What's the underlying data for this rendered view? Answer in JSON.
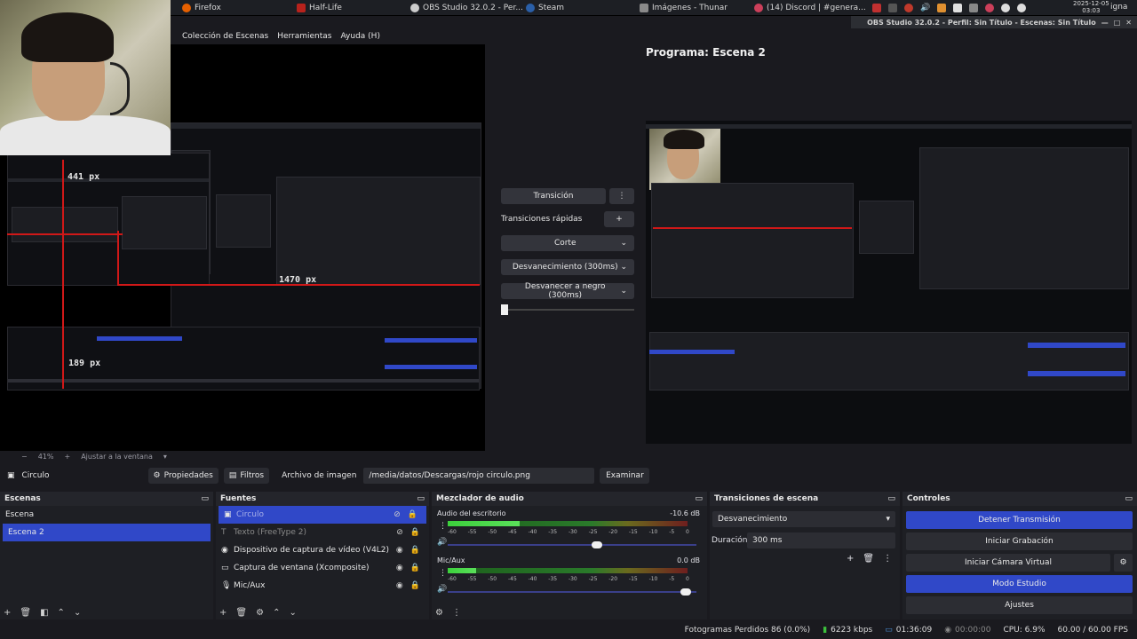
{
  "taskbar": {
    "items": [
      {
        "label": "Firefox",
        "color": "#e66000"
      },
      {
        "label": "Half-Life",
        "color": "#b8221c"
      },
      {
        "label": "OBS Studio 32.0.2 - Per...",
        "color": "#cccccc"
      },
      {
        "label": "Steam",
        "color": "#2a5fa8"
      },
      {
        "label": "Imágenes - Thunar",
        "color": "#8a8a8a"
      },
      {
        "label": "(14) Discord | #genera...",
        "color": "#cc3f5a"
      }
    ],
    "date": "2025-12-05",
    "time": "03:03",
    "user": "igna"
  },
  "window_title": "OBS Studio 32.0.2 - Perfil: Sin Título - Escenas: Sin Título",
  "menu": [
    "Colección de Escenas",
    "Herramientas",
    "Ayuda (H)"
  ],
  "preview": {
    "labels": [
      "441 px",
      "1470 px",
      "189 px"
    ],
    "zoom": "41%",
    "fit": "Ajustar a la ventana",
    "plus": "+",
    "minus": "−"
  },
  "transition_panel": {
    "transition_button": "Transición",
    "quick_label": "Transiciones rápidas",
    "items": [
      "Corte",
      "Desvanecimiento (300ms)",
      "Desvanecer a negro (300ms)"
    ]
  },
  "program": {
    "title": "Programa: Escena 2"
  },
  "source_toolbar": {
    "source": "Circulo",
    "properties": "Propiedades",
    "filters": "Filtros",
    "image_file_label": "Archivo de imagen",
    "image_path": "/media/datos/Descargas/rojo circulo.png",
    "browse": "Examinar"
  },
  "scenes": {
    "title": "Escenas",
    "items": [
      {
        "label": "Escena",
        "selected": false
      },
      {
        "label": "Escena 2",
        "selected": true
      }
    ]
  },
  "sources": {
    "title": "Fuentes",
    "items": [
      {
        "label": "Circulo",
        "icon": "image-icon",
        "visible": false,
        "selected": true
      },
      {
        "label": "Texto (FreeType 2)",
        "icon": "text-icon",
        "visible": false,
        "selected": false
      },
      {
        "label": "Dispositivo de captura de vídeo (V4L2)",
        "icon": "camera-icon",
        "visible": true,
        "selected": false
      },
      {
        "label": "Captura de ventana (Xcomposite)",
        "icon": "window-icon",
        "visible": true,
        "selected": false
      },
      {
        "label": "Mic/Aux",
        "icon": "mic-icon",
        "visible": true,
        "selected": false
      }
    ]
  },
  "audio": {
    "title": "Mezclador de audio",
    "ticks": [
      "-60",
      "-55",
      "-50",
      "-45",
      "-40",
      "-35",
      "-30",
      "-25",
      "-20",
      "-15",
      "-10",
      "-5",
      "0"
    ],
    "channels": [
      {
        "name": "Audio del escritorio",
        "db": "-10.6 dB",
        "level": 0.3,
        "volume": 0.62
      },
      {
        "name": "Mic/Aux",
        "db": "0.0 dB",
        "level": 0.12,
        "volume": 0.98
      }
    ]
  },
  "scene_transitions": {
    "title": "Transiciones de escena",
    "selected": "Desvanecimiento",
    "duration_label": "Duración",
    "duration_value": "300 ms"
  },
  "controls": {
    "title": "Controles",
    "buttons": [
      {
        "label": "Detener Transmisión",
        "active": true
      },
      {
        "label": "Iniciar Grabación",
        "active": false
      },
      {
        "label": "Iniciar Cámara Virtual",
        "active": false
      },
      {
        "label": "Modo Estudio",
        "active": true
      },
      {
        "label": "Ajustes",
        "active": false
      }
    ]
  },
  "status": {
    "dropped": "Fotogramas Perdidos 86 (0.0%)",
    "bitrate": "6223 kbps",
    "stream_time": "01:36:09",
    "rec_time": "00:00:00",
    "cpu": "CPU: 6.9%",
    "fps": "60.00 / 60.00 FPS"
  },
  "colors": {
    "accent": "#3048c8",
    "red": "#d01818",
    "bg": "#1a1a1f"
  }
}
